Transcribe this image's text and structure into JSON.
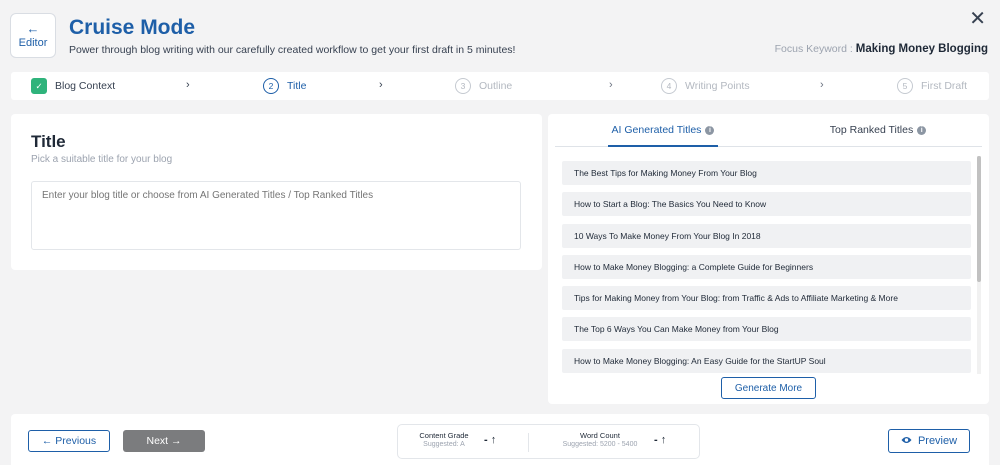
{
  "header": {
    "editor_arrow": "←",
    "editor_label": "Editor",
    "title": "Cruise Mode",
    "subtitle": "Power through blog writing with our carefully created workflow to get your first draft in 5 minutes!",
    "close_glyph": "✕",
    "focus_label": "Focus Keyword : ",
    "focus_value": "Making Money Blogging"
  },
  "steps": [
    {
      "num": "✓",
      "label": "Blog Context",
      "state": "done"
    },
    {
      "num": "2",
      "label": "Title",
      "state": "active"
    },
    {
      "num": "3",
      "label": "Outline",
      "state": "pending"
    },
    {
      "num": "4",
      "label": "Writing Points",
      "state": "pending"
    },
    {
      "num": "5",
      "label": "First Draft",
      "state": "pending"
    }
  ],
  "step_chevron": "›",
  "title_section": {
    "heading": "Title",
    "hint": "Pick a suitable title for your blog",
    "input_placeholder": "Enter your blog title or choose from AI Generated Titles / Top Ranked Titles"
  },
  "tabs": {
    "ai_label": "AI Generated Titles",
    "top_label": "Top Ranked Titles",
    "info_glyph": "i"
  },
  "titles": [
    "The Best Tips for Making Money From Your Blog",
    "How to Start a Blog: The Basics You Need to Know",
    "10 Ways To Make Money From Your Blog In 2018",
    "How to Make Money Blogging: a Complete Guide for Beginners",
    "Tips for Making Money from Your Blog: from Traffic & Ads to Affiliate Marketing & More",
    "The Top 6 Ways You Can Make Money from Your Blog",
    "How to Make Money Blogging: An Easy Guide for the StartUP Soul"
  ],
  "generate_more": "Generate More",
  "footer": {
    "prev_label": "← Previous",
    "next_label": "Next →",
    "grade_label": "Content Grade",
    "grade_suggested": "Suggested: A",
    "grade_value": "- ↑",
    "wc_label": "Word Count",
    "wc_suggested": "Suggested: 5200 - 5400",
    "wc_value": "- ↑",
    "preview_label": "Preview",
    "eye_glyph": "👁"
  },
  "colors": {
    "accent": "#1e5fa8",
    "done_green": "#2fb37b",
    "background": "#f3f3f4"
  }
}
